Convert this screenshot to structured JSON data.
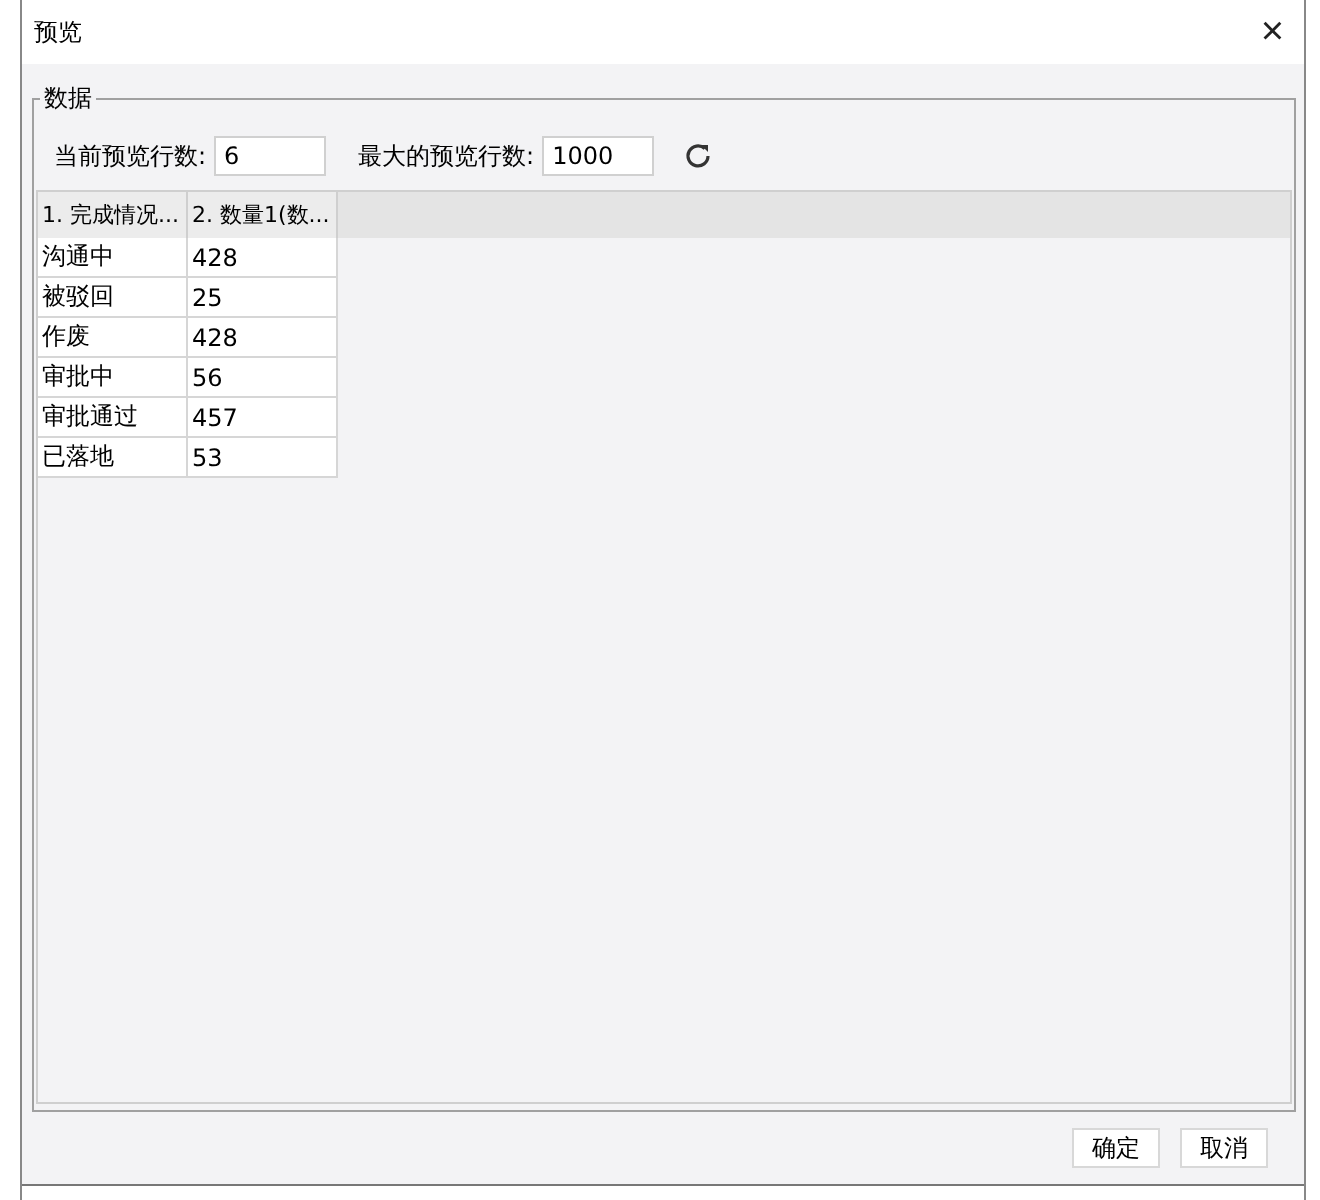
{
  "window": {
    "title": "预览",
    "close": "×"
  },
  "group": {
    "title": "数据"
  },
  "fields": [
    {
      "label": "当前预览行数:",
      "value": "6"
    },
    {
      "label": "最大的预览行数:",
      "value": "1000"
    }
  ],
  "table": {
    "columns": [
      "1. 完成情况...",
      "2. 数量1(数..."
    ],
    "rows": [
      [
        "沟通中",
        "428"
      ],
      [
        "被驳回",
        "25"
      ],
      [
        "作废",
        "428"
      ],
      [
        "审批中",
        "56"
      ],
      [
        "审批通过",
        "457"
      ],
      [
        "已落地",
        "53"
      ]
    ]
  },
  "buttons": [
    "确定",
    "取消"
  ]
}
